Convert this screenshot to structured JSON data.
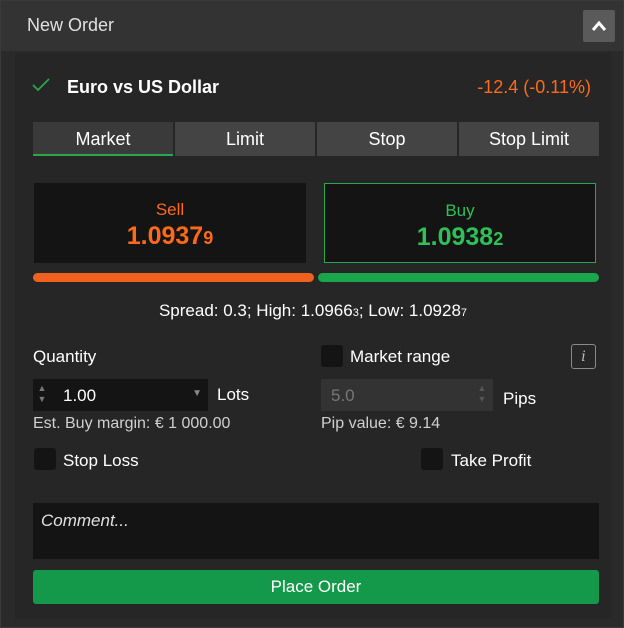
{
  "header": {
    "title": "New Order",
    "collapse_icon": "chevron-up-icon"
  },
  "instrument": {
    "name": "Euro vs US Dollar",
    "change": "-12.4 (-0.11%)",
    "status_icon": "check-icon",
    "change_color": "#ff6a1a"
  },
  "order_types": {
    "tabs": [
      {
        "label": "Market",
        "active": true
      },
      {
        "label": "Limit",
        "active": false
      },
      {
        "label": "Stop",
        "active": false
      },
      {
        "label": "Stop Limit",
        "active": false
      }
    ]
  },
  "sell": {
    "label": "Sell",
    "price_main": "1.0937",
    "price_pip": "9",
    "color": "#ff6a1a"
  },
  "buy": {
    "label": "Buy",
    "price_main": "1.0938",
    "price_pip": "2",
    "color": "#2fc059"
  },
  "spread": {
    "prefix": "Spread: 0.3; High: 1.0966",
    "high_pip": "3",
    "low_text": "; Low: 1.0928",
    "low_pip": "7"
  },
  "quantity": {
    "label": "Quantity",
    "value": "1.00",
    "unit": "Lots",
    "margin_text": "Est. Buy margin: € 1 000.00"
  },
  "market_range": {
    "label": "Market range",
    "checked": false,
    "value": "5.0",
    "unit": "Pips",
    "pip_value_text": "Pip value: € 9.14",
    "info_icon": "info-icon"
  },
  "stop_loss": {
    "label": "Stop Loss",
    "checked": false
  },
  "take_profit": {
    "label": "Take Profit",
    "checked": false
  },
  "comment": {
    "placeholder": "Comment..."
  },
  "place_order": {
    "label": "Place Order"
  },
  "colors": {
    "accent_green": "#14984a",
    "sell_orange": "#f0601e",
    "buy_green": "#1aa64a"
  }
}
